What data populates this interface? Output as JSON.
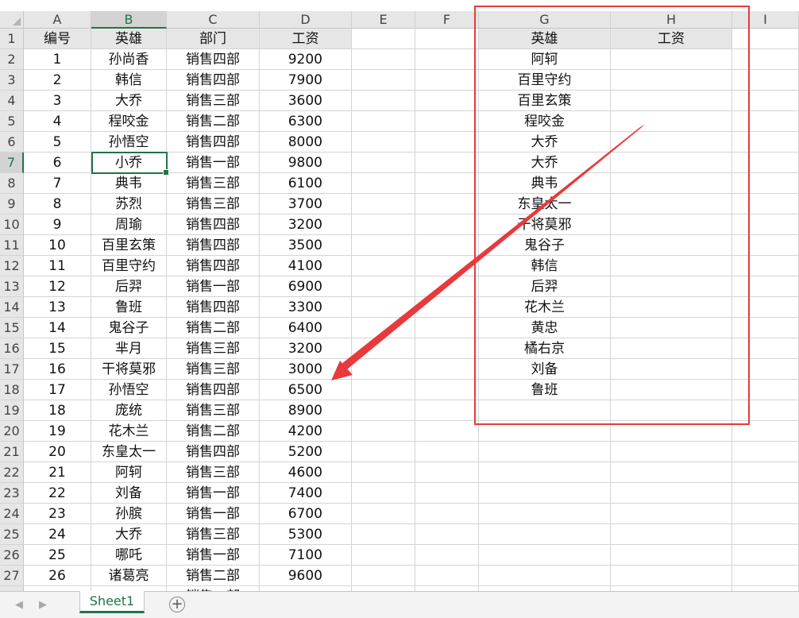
{
  "columns": [
    "A",
    "B",
    "C",
    "D",
    "E",
    "F",
    "G",
    "H",
    "I"
  ],
  "selected_col": "B",
  "selected_row": 7,
  "table": {
    "headers": [
      "编号",
      "英雄",
      "部门",
      "工资"
    ],
    "rows": [
      [
        "1",
        "孙尚香",
        "销售四部",
        "9200"
      ],
      [
        "2",
        "韩信",
        "销售四部",
        "7900"
      ],
      [
        "3",
        "大乔",
        "销售三部",
        "3600"
      ],
      [
        "4",
        "程咬金",
        "销售二部",
        "6300"
      ],
      [
        "5",
        "孙悟空",
        "销售四部",
        "8000"
      ],
      [
        "6",
        "小乔",
        "销售一部",
        "9800"
      ],
      [
        "7",
        "典韦",
        "销售三部",
        "6100"
      ],
      [
        "8",
        "苏烈",
        "销售三部",
        "3700"
      ],
      [
        "9",
        "周瑜",
        "销售四部",
        "3200"
      ],
      [
        "10",
        "百里玄策",
        "销售四部",
        "3500"
      ],
      [
        "11",
        "百里守约",
        "销售四部",
        "4100"
      ],
      [
        "12",
        "后羿",
        "销售一部",
        "6900"
      ],
      [
        "13",
        "鲁班",
        "销售四部",
        "3300"
      ],
      [
        "14",
        "鬼谷子",
        "销售二部",
        "6400"
      ],
      [
        "15",
        "芈月",
        "销售三部",
        "3200"
      ],
      [
        "16",
        "干将莫邪",
        "销售三部",
        "3000"
      ],
      [
        "17",
        "孙悟空",
        "销售四部",
        "6500"
      ],
      [
        "18",
        "庞统",
        "销售三部",
        "8900"
      ],
      [
        "19",
        "花木兰",
        "销售二部",
        "4200"
      ],
      [
        "20",
        "东皇太一",
        "销售四部",
        "5200"
      ],
      [
        "21",
        "阿轲",
        "销售三部",
        "4600"
      ],
      [
        "22",
        "刘备",
        "销售一部",
        "7400"
      ],
      [
        "23",
        "孙膑",
        "销售一部",
        "6700"
      ],
      [
        "24",
        "大乔",
        "销售三部",
        "5300"
      ],
      [
        "25",
        "哪吒",
        "销售一部",
        "7100"
      ],
      [
        "26",
        "诸葛亮",
        "销售二部",
        "9600"
      ],
      [
        "",
        "",
        "销售一部",
        ""
      ]
    ]
  },
  "lookup": {
    "headers": [
      "英雄",
      "工资"
    ],
    "names": [
      "阿轲",
      "百里守约",
      "百里玄策",
      "程咬金",
      "大乔",
      "大乔",
      "典韦",
      "东皇太一",
      "干将莫邪",
      "鬼谷子",
      "韩信",
      "后羿",
      "花木兰",
      "黄忠",
      "橘右京",
      "刘备",
      "鲁班"
    ]
  },
  "tabs": {
    "sheet": "Sheet1",
    "add": "+"
  },
  "nav": {
    "prev": "◀",
    "next": "▶"
  },
  "colors": {
    "accent": "#217346",
    "annotation": "#e8393c"
  }
}
